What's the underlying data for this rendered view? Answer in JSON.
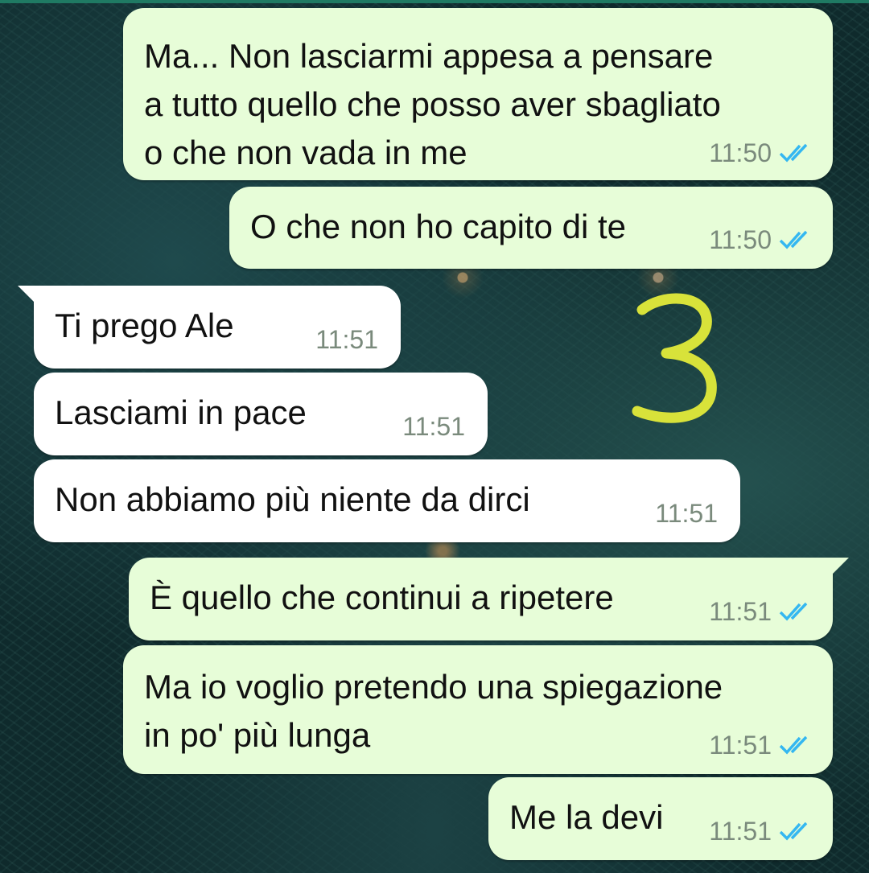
{
  "annotation": {
    "text": "3",
    "color": "#d8e23a"
  },
  "colors": {
    "outgoing_bubble": "#e7fdd8",
    "incoming_bubble": "#ffffff",
    "read_ticks": "#34b7f1",
    "time_text": "#7a8a7c"
  },
  "messages": [
    {
      "direction": "out",
      "text": "Ma... Non lasciarmi appesa a pensare\na tutto quello che posso aver sbagliato\no che non vada in me",
      "time": "11:50",
      "status": "read"
    },
    {
      "direction": "out",
      "text": "O che non ho capito di te",
      "time": "11:50",
      "status": "read"
    },
    {
      "direction": "in",
      "text": "Ti prego Ale",
      "time": "11:51"
    },
    {
      "direction": "in",
      "text": "Lasciami in pace",
      "time": "11:51"
    },
    {
      "direction": "in",
      "text": "Non abbiamo più niente da dirci",
      "time": "11:51"
    },
    {
      "direction": "out",
      "text": "È quello che continui a ripetere",
      "time": "11:51",
      "status": "read"
    },
    {
      "direction": "out",
      "text": "Ma io voglio pretendo una spiegazione\nin po' più lunga",
      "time": "11:51",
      "status": "read"
    },
    {
      "direction": "out",
      "text": "Me la devi",
      "time": "11:51",
      "status": "read"
    }
  ]
}
